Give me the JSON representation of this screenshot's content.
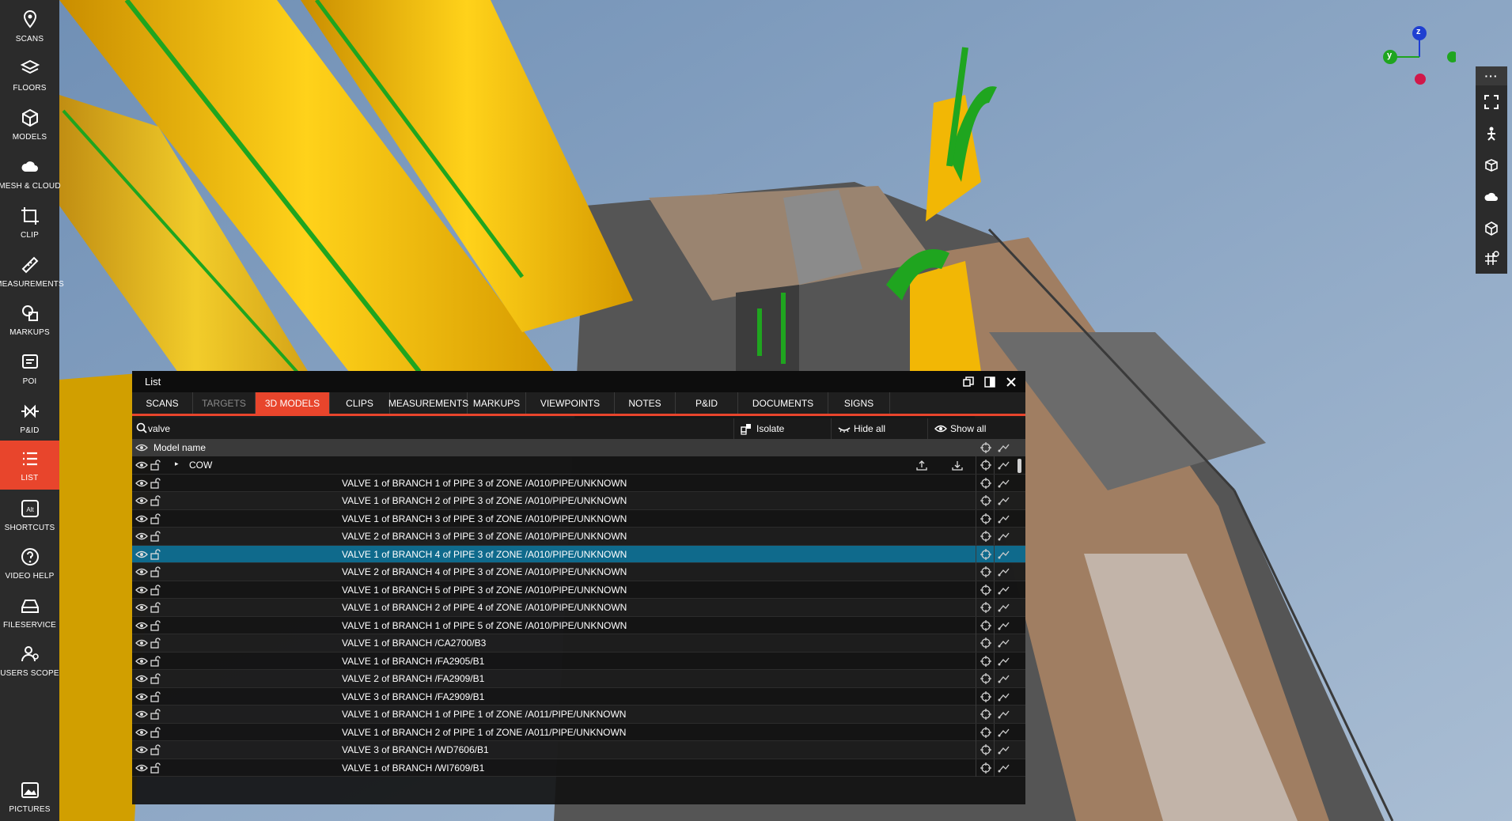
{
  "sidebar": {
    "items": [
      {
        "label": "SCANS",
        "icon": "map-pin-icon",
        "active": false
      },
      {
        "label": "FLOORS",
        "icon": "layers-icon",
        "active": false
      },
      {
        "label": "MODELS",
        "icon": "cube-icon",
        "active": false
      },
      {
        "label": "MESH & CLOUD",
        "icon": "cloud-points-icon",
        "active": false
      },
      {
        "label": "CLIP",
        "icon": "crop-icon",
        "active": false
      },
      {
        "label": "MEASUREMENTS",
        "icon": "ruler-icon",
        "active": false
      },
      {
        "label": "MARKUPS",
        "icon": "shapes-icon",
        "active": false
      },
      {
        "label": "POI",
        "icon": "note-icon",
        "active": false
      },
      {
        "label": "P&ID",
        "icon": "valve-symbol-icon",
        "active": false
      },
      {
        "label": "LIST",
        "icon": "list-icon",
        "active": true
      },
      {
        "label": "SHORTCUTS",
        "icon": "keyboard-alt-icon",
        "active": false
      },
      {
        "label": "VIDEO HELP",
        "icon": "help-circle-icon",
        "active": false
      },
      {
        "label": "FILESERVICE",
        "icon": "drive-icon",
        "active": false
      },
      {
        "label": "USERS SCOPE",
        "icon": "users-icon",
        "active": false
      }
    ],
    "bottom_item": {
      "label": "PICTURES",
      "icon": "picture-icon"
    }
  },
  "gizmo": {
    "z_label": "z",
    "y_label": "y"
  },
  "right_toolbar": {
    "more_label": "···",
    "buttons": [
      "fullscreen-icon",
      "person-nav-icon",
      "box-section-icon",
      "point-cloud-icon",
      "cube-outline-icon",
      "grid-settings-icon"
    ]
  },
  "list_panel": {
    "title": "List",
    "tabs": [
      {
        "label": "SCANS",
        "state": "normal"
      },
      {
        "label": "TARGETS",
        "state": "dim"
      },
      {
        "label": "3D MODELS",
        "state": "active"
      },
      {
        "label": "CLIPS",
        "state": "normal"
      },
      {
        "label": "MEASUREMENTS",
        "state": "normal"
      },
      {
        "label": "MARKUPS",
        "state": "normal"
      },
      {
        "label": "VIEWPOINTS",
        "state": "normal"
      },
      {
        "label": "NOTES",
        "state": "normal"
      },
      {
        "label": "P&ID",
        "state": "normal"
      },
      {
        "label": "DOCUMENTS",
        "state": "normal"
      },
      {
        "label": "SIGNS",
        "state": "normal"
      }
    ],
    "search": {
      "value": "valve"
    },
    "actions": {
      "isolate": "Isolate",
      "hide_all": "Hide all",
      "show_all": "Show all"
    },
    "header": {
      "model_name": "Model name"
    },
    "group": {
      "label": "COW"
    },
    "rows": [
      "VALVE 1 of BRANCH 1 of PIPE 3 of ZONE /A010/PIPE/UNKNOWN",
      "VALVE 1 of BRANCH 2 of PIPE 3 of ZONE /A010/PIPE/UNKNOWN",
      "VALVE 1 of BRANCH 3 of PIPE 3 of ZONE /A010/PIPE/UNKNOWN",
      "VALVE 2 of BRANCH 3 of PIPE 3 of ZONE /A010/PIPE/UNKNOWN",
      "VALVE 1 of BRANCH 4 of PIPE 3 of ZONE /A010/PIPE/UNKNOWN",
      "VALVE 2 of BRANCH 4 of PIPE 3 of ZONE /A010/PIPE/UNKNOWN",
      "VALVE 1 of BRANCH 5 of PIPE 3 of ZONE /A010/PIPE/UNKNOWN",
      "VALVE 1 of BRANCH 2 of PIPE 4 of ZONE /A010/PIPE/UNKNOWN",
      "VALVE 1 of BRANCH 1 of PIPE 5 of ZONE /A010/PIPE/UNKNOWN",
      "VALVE 1 of BRANCH /CA2700/B3",
      "VALVE 1 of BRANCH /FA2905/B1",
      "VALVE 2 of BRANCH /FA2909/B1",
      "VALVE 3 of BRANCH /FA2909/B1",
      "VALVE 1 of BRANCH 1 of PIPE 1 of ZONE /A011/PIPE/UNKNOWN",
      "VALVE 1 of BRANCH 2 of PIPE 1 of ZONE /A011/PIPE/UNKNOWN",
      "VALVE 3 of BRANCH /WD7606/B1",
      "VALVE 1 of BRANCH /WI7609/B1"
    ],
    "selected_row": 4
  },
  "colors": {
    "accent": "#e8452c",
    "selected_row": "#0f6a8c",
    "sidebar_bg": "#2b2b2b",
    "pipe_yellow": "#f2b705",
    "pipe_green": "#1fa51f",
    "sky": "#8fa8c4"
  }
}
